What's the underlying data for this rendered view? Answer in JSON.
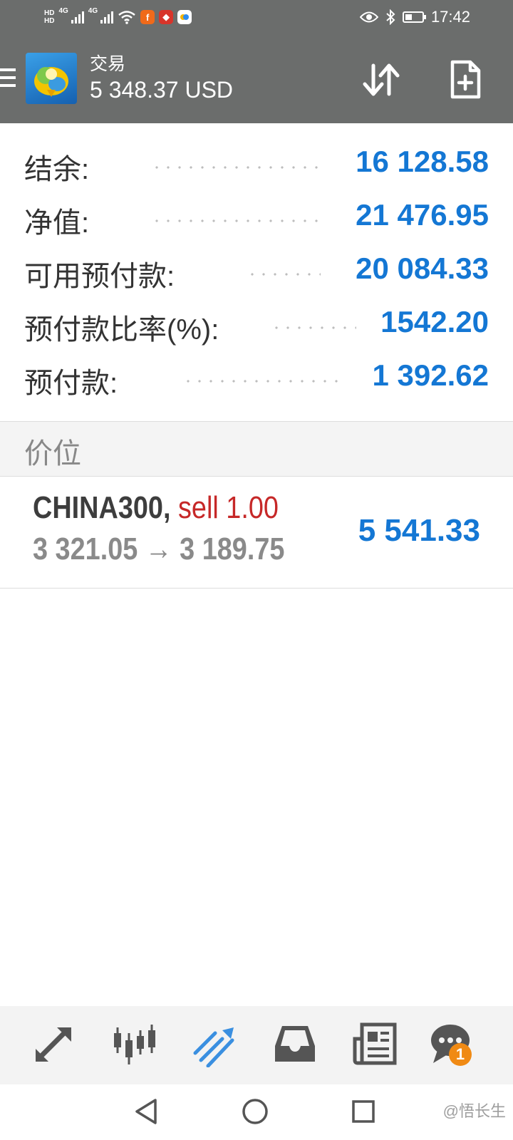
{
  "status_bar": {
    "hd1": "HD",
    "hd2": "HD",
    "net1": "4G",
    "net2": "4G",
    "time": "17:42"
  },
  "header": {
    "title": "交易",
    "balance_display": "5 348.37 USD"
  },
  "account": [
    {
      "label": "结余:",
      "value": "16 128.58"
    },
    {
      "label": "净值:",
      "value": "21 476.95"
    },
    {
      "label": "可用预付款:",
      "value": "20 084.33"
    },
    {
      "label": "预付款比率(%):",
      "value": "1542.20"
    },
    {
      "label": "预付款:",
      "value": "1 392.62"
    }
  ],
  "section_title": "价位",
  "position": {
    "symbol": "CHINA300,",
    "side": "sell 1.00",
    "price_range": "3 321.05 → 3 189.75",
    "profit": "5 541.33"
  },
  "bottom_nav": {
    "items": [
      "trade-arrows-icon",
      "candlestick-chart-icon",
      "trend-lines-icon",
      "inbox-icon",
      "news-icon",
      "chat-icon"
    ],
    "active_index": 2,
    "chat_badge": "1"
  },
  "watermark": "@悟长生",
  "colors": {
    "header_bg": "#6b6d6c",
    "value_blue": "#1477d4",
    "sell_red": "#c62828",
    "active_icon": "#3a8fe0",
    "badge_orange": "#f08a14"
  }
}
